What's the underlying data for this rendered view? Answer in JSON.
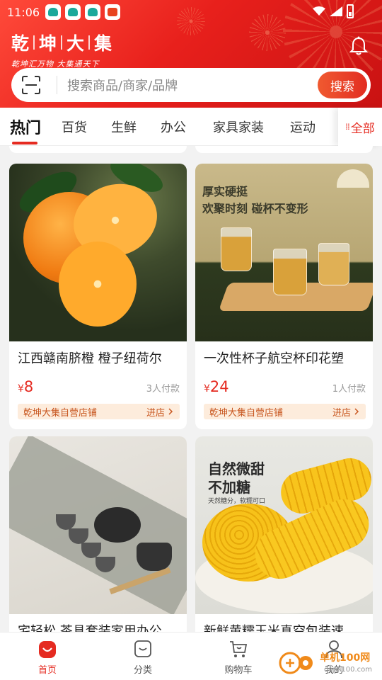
{
  "status_bar": {
    "time": "11:06"
  },
  "brand": {
    "title_chars": [
      "乾",
      "坤",
      "大",
      "集"
    ],
    "subtitle": "乾坤汇万物 大集通天下"
  },
  "search": {
    "placeholder": "搜索商品/商家/品牌",
    "button_label": "搜索"
  },
  "tabs": [
    "热门",
    "百货",
    "生鲜",
    "办公",
    "家具家装",
    "运动"
  ],
  "tabs_all_label": "全部",
  "products": [
    {
      "title": "江西赣南脐橙 橙子纽荷尔",
      "currency": "¥",
      "price": "8",
      "sold": "3人付款",
      "store": "乾坤大集自营店铺",
      "enter": "进店"
    },
    {
      "title": "一次性杯子航空杯印花塑",
      "currency": "¥",
      "price": "24",
      "sold": "1人付款",
      "store": "乾坤大集自营店铺",
      "enter": "进店",
      "image_text": [
        "厚实硬挺",
        "欢聚时刻 碰杯不变形"
      ]
    },
    {
      "title": "宅轻松 茶具套装家用办公"
    },
    {
      "title": "新鲜黄糯玉米真空包装速",
      "image_text": [
        "自然微甜",
        "不加糖",
        "天然糖分，软糯可口"
      ]
    }
  ],
  "bottom_nav": [
    {
      "label": "首页",
      "icon": "home-icon",
      "active": true
    },
    {
      "label": "分类",
      "icon": "category-icon",
      "active": false
    },
    {
      "label": "购物车",
      "icon": "cart-icon",
      "active": false
    },
    {
      "label": "我的",
      "icon": "profile-icon",
      "active": false
    }
  ],
  "watermark": {
    "text": "单机100网",
    "url": "danji100.com"
  },
  "colors": {
    "brand_red": "#e52b21",
    "header_gradient_start": "#ff4a3a",
    "header_gradient_end": "#c91212",
    "store_bg": "#fdecdc",
    "store_text": "#c8561f"
  }
}
